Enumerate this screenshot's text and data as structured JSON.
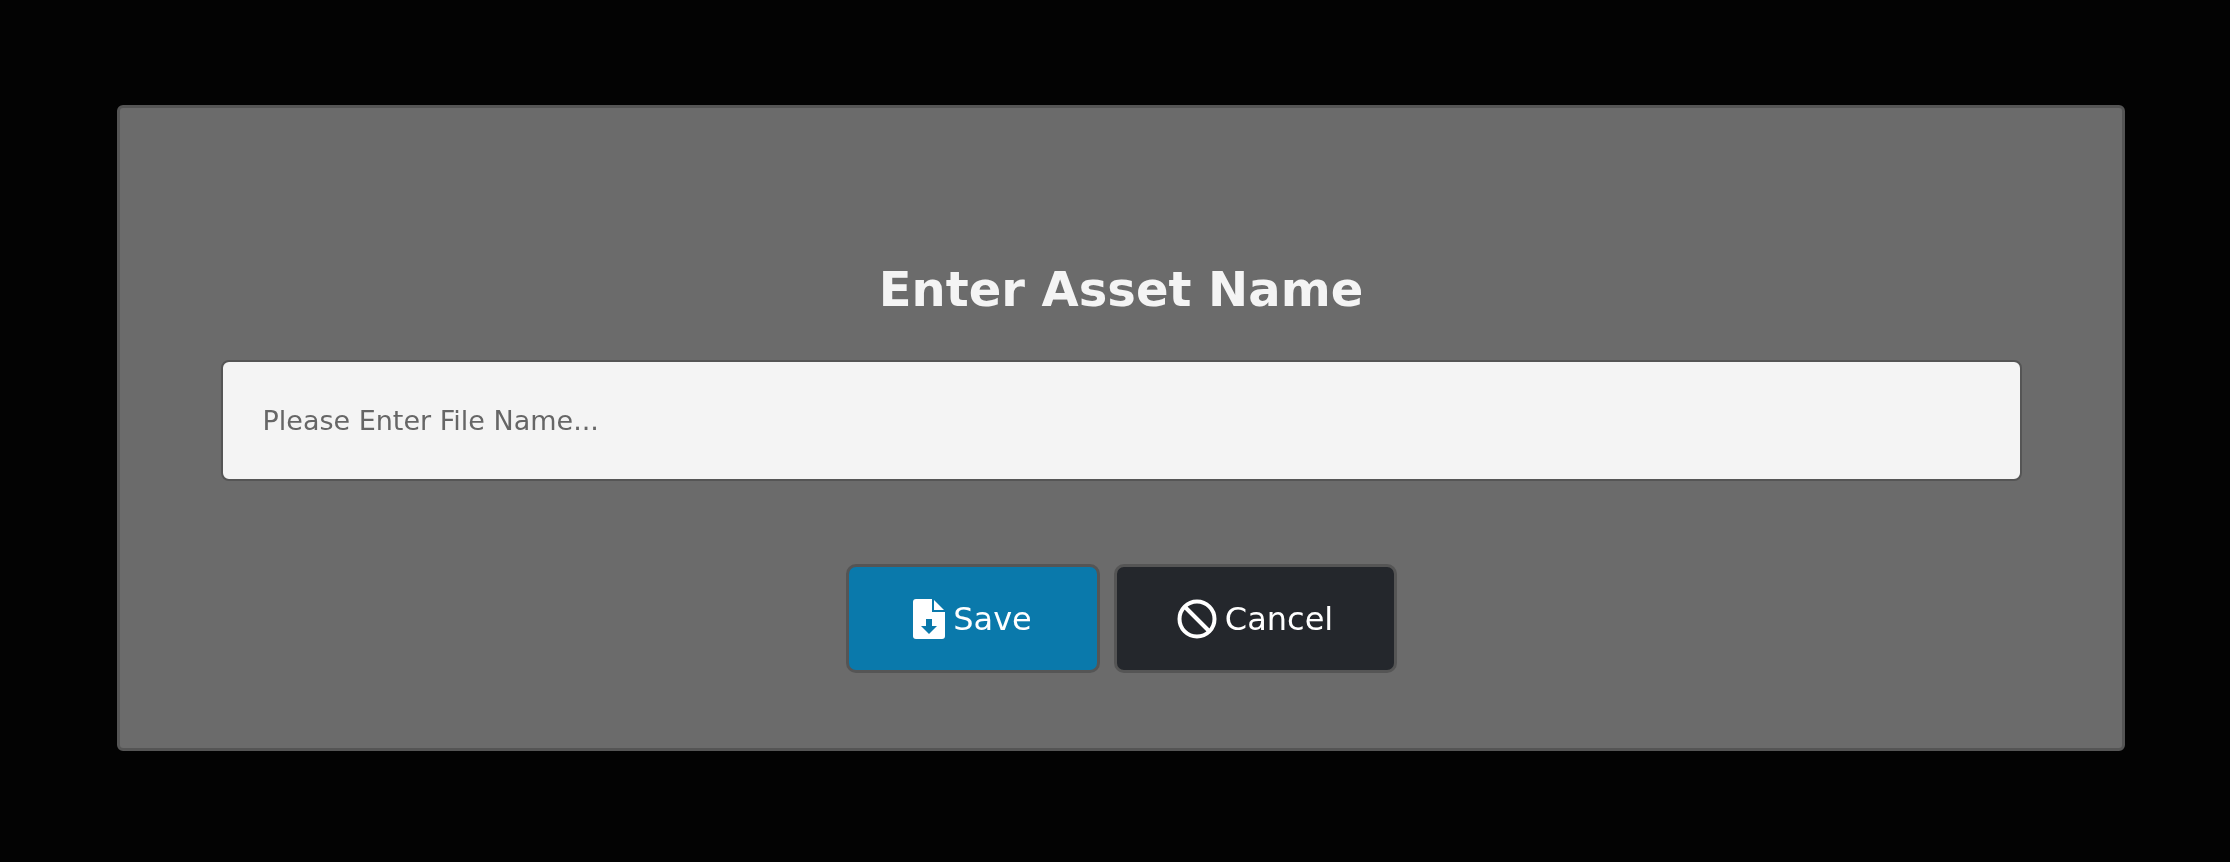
{
  "dialog": {
    "title": "Enter Asset Name",
    "field": {
      "placeholder": "Please Enter File Name..."
    },
    "buttons": [
      {
        "kind": "save",
        "label": "Save"
      },
      {
        "kind": "cancel",
        "label": "Cancel"
      }
    ]
  }
}
